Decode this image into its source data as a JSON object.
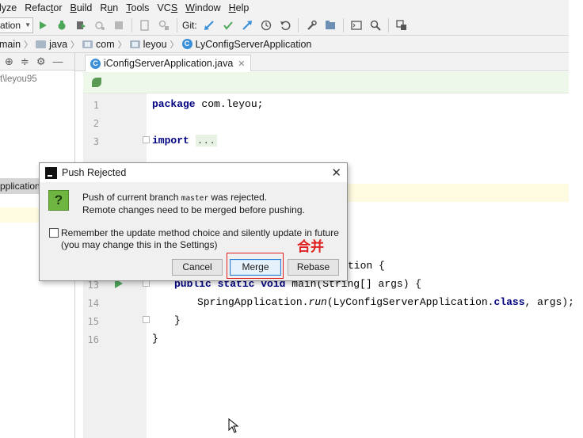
{
  "menubar": {
    "items": [
      {
        "pre": "",
        "ul": "",
        "post": "lyze"
      },
      {
        "pre": "Refac",
        "ul": "t",
        "post": "or"
      },
      {
        "pre": "",
        "ul": "B",
        "post": "uild"
      },
      {
        "pre": "R",
        "ul": "u",
        "post": "n"
      },
      {
        "pre": "",
        "ul": "T",
        "post": "ools"
      },
      {
        "pre": "VC",
        "ul": "S",
        "post": ""
      },
      {
        "pre": "",
        "ul": "W",
        "post": "indow"
      },
      {
        "pre": "",
        "ul": "H",
        "post": "elp"
      }
    ]
  },
  "toolbar": {
    "run_config": "ation",
    "git_label": "Git:"
  },
  "breadcrumb": {
    "items": [
      "main",
      "java",
      "com",
      "leyou",
      "LyConfigServerApplication"
    ]
  },
  "project": {
    "path": "t\\leyou95",
    "selected": "pplication"
  },
  "editor": {
    "tab_label": "iConfigServerApplication.java",
    "line_numbers": [
      "1",
      "2",
      "3",
      "13",
      "14",
      "15",
      "16"
    ],
    "line1": {
      "kw": "package",
      "rest": " com.leyou;"
    },
    "line3": {
      "kw": "import",
      "dots": "..."
    },
    "line_partial": "tion {",
    "line13": {
      "kw1": "public",
      "kw2": "static",
      "kw3": "void",
      "rest": " main(String[] args) {"
    },
    "line14": {
      "cls": "SpringApplication.",
      "method": "run",
      "args": "(LyConfigServerApplication.",
      "kw": "class",
      "tail": ", args);"
    },
    "line15": "}",
    "line16": "}"
  },
  "dialog": {
    "title": "Push Rejected",
    "msg1_pre": "Push of current branch ",
    "msg1_branch": "master",
    "msg1_post": " was rejected.",
    "msg2": "Remote changes need to be merged before pushing.",
    "checkbox_line1": "Remember the update method choice and silently update in future",
    "checkbox_line2": "(you may change this in the Settings)",
    "cancel": "Cancel",
    "merge": "Merge",
    "rebase": "Rebase"
  },
  "annotation": {
    "text": "合并",
    "color": "#e02020"
  },
  "colors": {
    "keyword": "#000080",
    "panel_bg": "#f2f2f2",
    "highlight": "#fefbe0"
  }
}
